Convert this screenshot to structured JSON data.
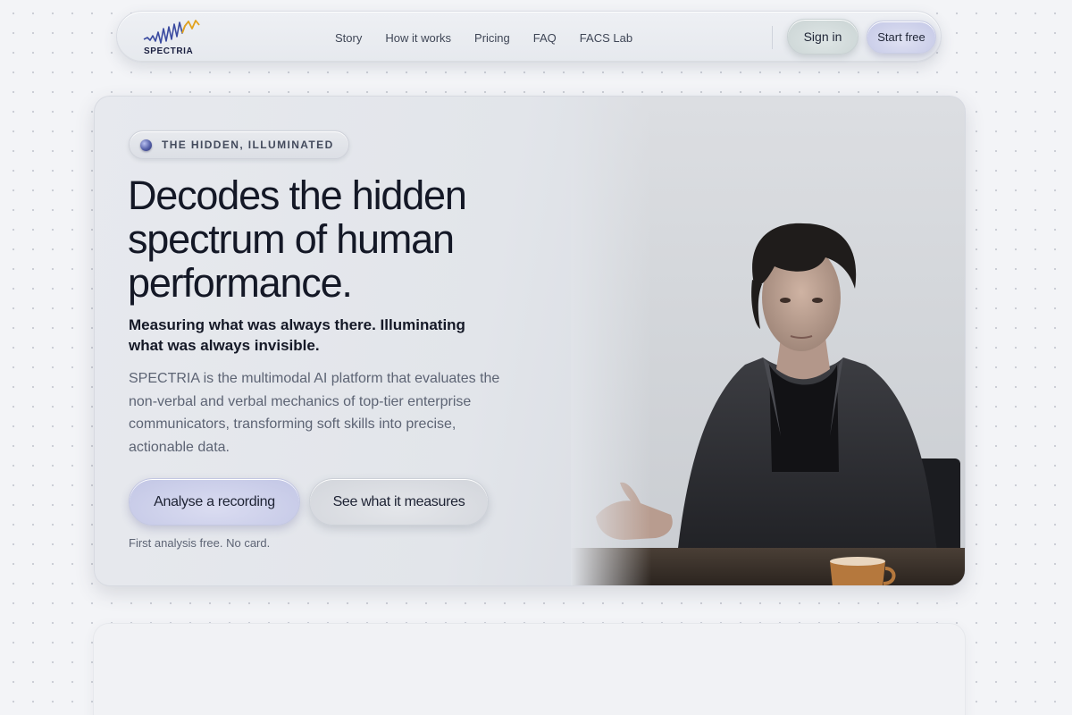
{
  "nav": {
    "logo_text": "SPECTRIA",
    "links": [
      "Story",
      "How it works",
      "Pricing",
      "FAQ",
      "FACS Lab"
    ],
    "signin_label": "Sign in",
    "start_label": "Start free"
  },
  "hero": {
    "eyebrow": "THE HIDDEN, ILLUMINATED",
    "headline": "Decodes the hidden spectrum of human performance.",
    "subhead": "Measuring what was always there. Illuminating what was always invisible.",
    "body": "SPECTRIA is the multimodal AI platform that evaluates the non-verbal and verbal mechanics of top-tier enterprise communicators, transforming soft skills into precise, actionable data.",
    "primary_cta": "Analyse a recording",
    "secondary_cta": "See what it measures",
    "fineprint": "First analysis free. No card."
  },
  "colors": {
    "accent": "#5560a8",
    "logo_wave": "#3a4aa0",
    "logo_peak": "#e2a21c",
    "background": "#f3f4f7"
  }
}
